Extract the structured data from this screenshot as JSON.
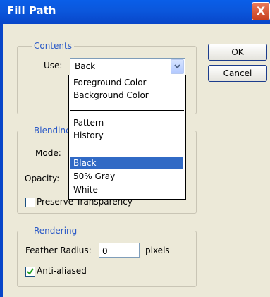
{
  "window": {
    "title": "Fill Path",
    "close_glyph": "X"
  },
  "buttons": {
    "ok": "OK",
    "cancel": "Cancel"
  },
  "contents": {
    "legend": "Contents",
    "use_label": "Use:",
    "use_value": "Back",
    "options": [
      "Foreground Color",
      "Background Color",
      "Pattern",
      "History",
      "Black",
      "50% Gray",
      "White"
    ],
    "selected": "Black"
  },
  "blending": {
    "legend": "Blendinc",
    "mode_label": "Mode:",
    "opacity_label": "Opacity:",
    "preserve_label": "Preserve Transparency"
  },
  "rendering": {
    "legend": "Rendering",
    "feather_label": "Feather Radius:",
    "feather_value": "0",
    "pixels_label": "pixels",
    "anti_aliased_label": "Anti-aliased",
    "anti_aliased_checked": true
  },
  "colors": {
    "titlebar": "#0b57dc",
    "accent": "#316ac5",
    "legend": "#2a59c7"
  },
  "icons": {
    "dropdown": "chevron-down-icon",
    "close": "close-icon",
    "check": "check-icon"
  }
}
